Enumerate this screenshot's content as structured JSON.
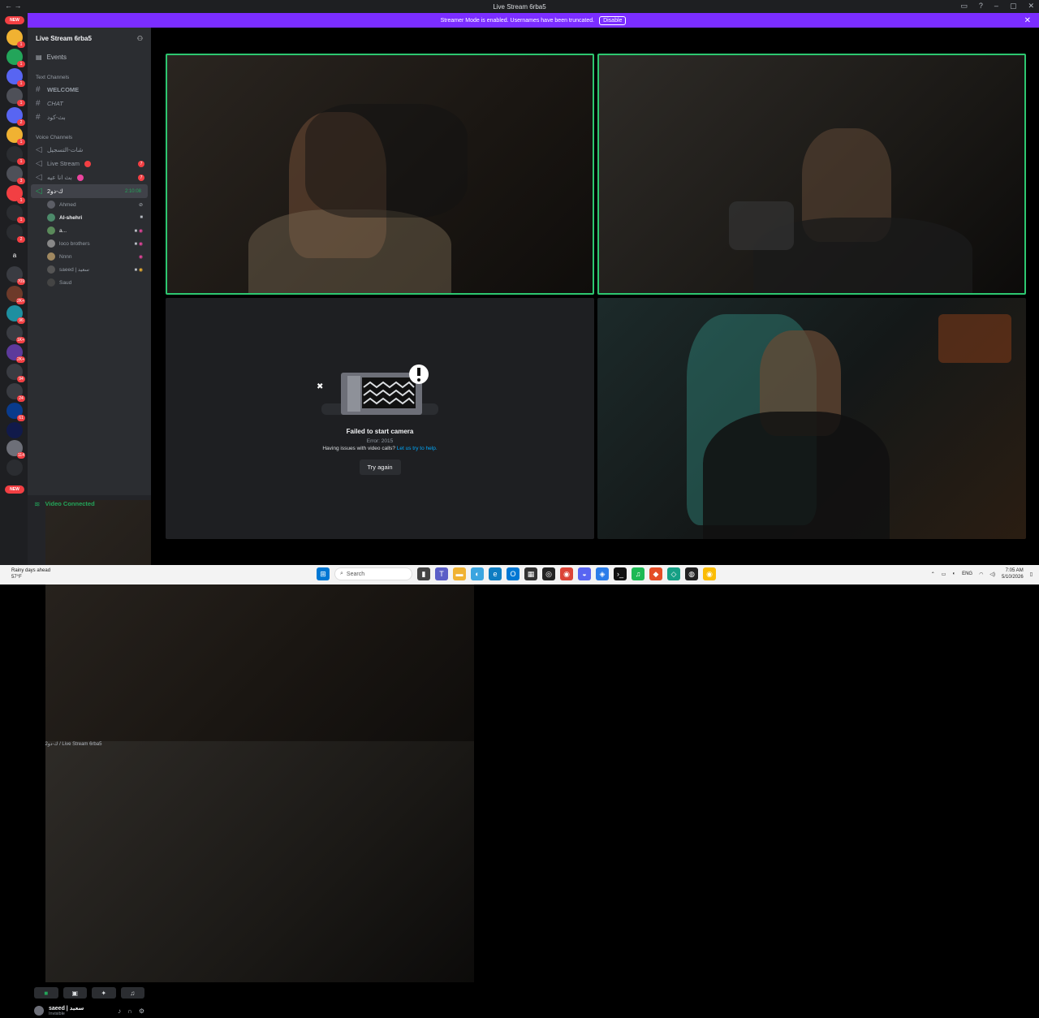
{
  "window": {
    "title": "Live Stream 6rba5"
  },
  "banner": {
    "text": "Streamer Mode is enabled. Usernames have been truncated.",
    "button": "Disable"
  },
  "guild_rail": {
    "new_top": "NEW",
    "new_bottom": "NEW",
    "badges": [
      "1",
      "1",
      "1",
      "1",
      "2",
      "1",
      "1",
      "3",
      "1",
      "1",
      "2",
      "1",
      "a",
      "709",
      "2K+",
      "96",
      "1K+",
      "2K+",
      "94",
      "24",
      "61",
      "114"
    ]
  },
  "sidebar": {
    "server_name": "Live Stream 6rba5",
    "events_label": "Events",
    "text_category": "Text Channels",
    "text_channels": [
      "WELCOME",
      "CHAT",
      "بث-كود"
    ],
    "voice_category": "Voice Channels",
    "voice_channels": [
      {
        "name": "شات-التسجيل",
        "badge": ""
      },
      {
        "name": "Live Stream",
        "badge": "7"
      },
      {
        "name": "بث انا عيه",
        "badge": "7"
      },
      {
        "name": "2ك-دو",
        "timer": "2:10:08"
      }
    ],
    "members": [
      {
        "name": "Ahmed",
        "icon": "mute-icon"
      },
      {
        "name": "Al-shehri",
        "icon": "camera-icon"
      },
      {
        "name": "a...",
        "icon": "camera-icon"
      },
      {
        "name": "loco brothers",
        "icon": "camera-icon"
      },
      {
        "name": "Nnnn",
        "icon": "camera-icon"
      },
      {
        "name": "saeed | سعيد",
        "icon": "camera-icon"
      },
      {
        "name": "Saud",
        "icon": ""
      }
    ]
  },
  "voice_panel": {
    "status": "Video Connected",
    "location": "2ك-دو / Live Stream 6rba5",
    "user_name": "saeed | سعيد",
    "user_status": "Invisible"
  },
  "camera_error": {
    "title": "Failed to start camera",
    "error": "Error: 2015",
    "help_text": "Having issues with video calls?",
    "help_link": "Let us try to help.",
    "button": "Try again"
  },
  "taskbar": {
    "weather_title": "Rainy days ahead",
    "weather_temp": "57°F",
    "search_placeholder": "Search",
    "lang": "ENG",
    "time": "7:05 AM",
    "date": "5/10/2026"
  },
  "colors": {
    "accent": "#7b2dff",
    "speaking": "#2dc770",
    "danger": "#f23f43",
    "online": "#23a55a"
  }
}
